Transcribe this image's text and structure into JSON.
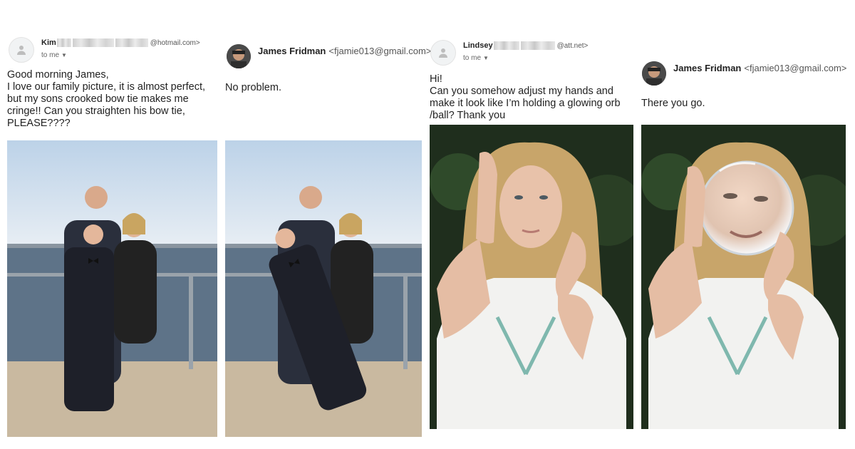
{
  "emails": [
    {
      "sender_name": "Kim",
      "sender_domain": "@hotmail.com>",
      "to": "to me",
      "body": "Good morning James,\nI love our family picture, it is almost perfect,\nbut my sons crooked bow tie makes me\ncringe!! Can you straighten his bow tie,\nPLEASE????"
    },
    {
      "sender_name": "James Fridman",
      "sender_address": "<fjamie013@gmail.com>",
      "body": "No problem."
    },
    {
      "sender_name": "Lindsey",
      "sender_domain": "@att.net>",
      "to": "to me",
      "body": "Hi!\nCan you somehow adjust my hands and\nmake it look like I’m holding a glowing orb\n/ball? Thank you"
    },
    {
      "sender_name": "James Fridman",
      "sender_address": "<fjamie013@gmail.com>",
      "body": "There you go."
    }
  ],
  "icons": {
    "default_avatar": "person-icon",
    "dropdown": "chevron-down-icon"
  },
  "colors": {
    "text": "#222222",
    "muted": "#666666",
    "avatar_bg": "#f1f3f4"
  }
}
